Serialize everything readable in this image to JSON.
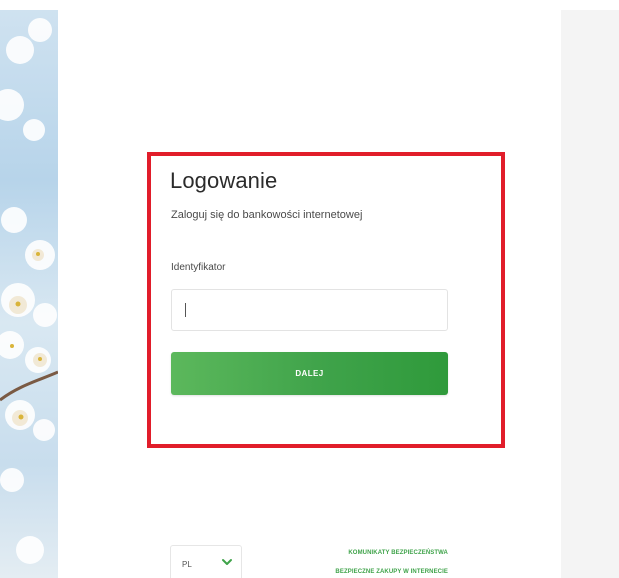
{
  "login": {
    "title": "Logowanie",
    "subtitle": "Zaloguj się do bankowości internetowej",
    "identifier_label": "Identyfikator",
    "identifier_value": "",
    "next_label": "DALEJ"
  },
  "footer": {
    "language": "PL",
    "links": [
      "KOMUNIKATY BEZPIECZEŃSTWA",
      "BEZPIECZNE ZAKUPY W INTERNECIE"
    ]
  },
  "colors": {
    "accent": "#3fa34a",
    "highlight": "#e11d2a"
  },
  "icons": {
    "language_dropdown": "chevron-down-icon"
  }
}
